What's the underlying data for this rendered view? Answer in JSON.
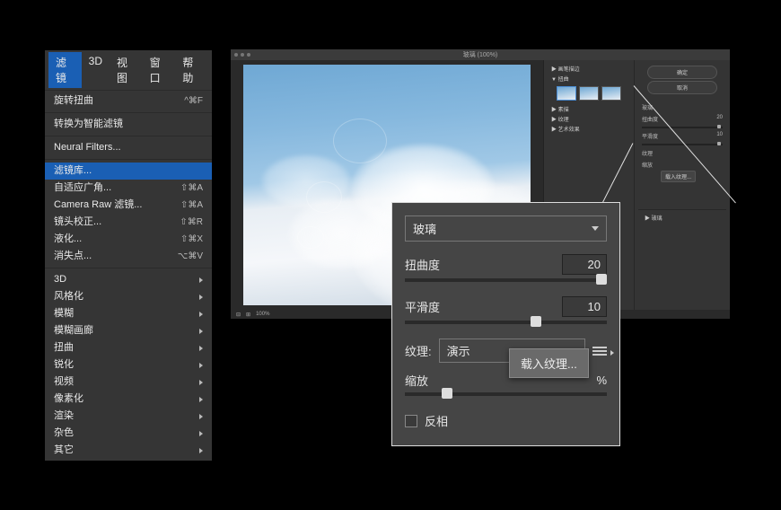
{
  "menubar": {
    "items": [
      "滤镜",
      "3D",
      "视图",
      "窗口",
      "帮助"
    ],
    "active_index": 0
  },
  "menu": {
    "section1": [
      {
        "label": "旋转扭曲",
        "shortcut": "^⌘F"
      }
    ],
    "section2": [
      {
        "label": "转换为智能滤镜"
      }
    ],
    "section3": [
      {
        "label": "Neural Filters..."
      }
    ],
    "section4": [
      {
        "label": "滤镜库...",
        "highlighted": true
      },
      {
        "label": "自适应广角...",
        "shortcut": "⇧⌘A"
      },
      {
        "label": "Camera Raw 滤镜...",
        "shortcut": "⇧⌘A"
      },
      {
        "label": "镜头校正...",
        "shortcut": "⇧⌘R"
      },
      {
        "label": "液化...",
        "shortcut": "⇧⌘X"
      },
      {
        "label": "消失点...",
        "shortcut": "⌥⌘V"
      }
    ],
    "section5": [
      {
        "label": "3D",
        "submenu": true
      },
      {
        "label": "风格化",
        "submenu": true
      },
      {
        "label": "模糊",
        "submenu": true
      },
      {
        "label": "模糊画廊",
        "submenu": true
      },
      {
        "label": "扭曲",
        "submenu": true
      },
      {
        "label": "锐化",
        "submenu": true
      },
      {
        "label": "视频",
        "submenu": true
      },
      {
        "label": "像素化",
        "submenu": true
      },
      {
        "label": "渲染",
        "submenu": true
      },
      {
        "label": "杂色",
        "submenu": true
      },
      {
        "label": "其它",
        "submenu": true
      }
    ]
  },
  "editor": {
    "title": "玻璃 (100%)",
    "zoom": "100%",
    "side": {
      "categories": [
        "▶ 画笔描边",
        "▼ 扭曲",
        "▶ 素描",
        "▶ 纹理",
        "▶ 艺术效果"
      ],
      "ok": "确定",
      "cancel": "取消",
      "mini_effect": "玻璃",
      "params": [
        {
          "label": "扭曲度",
          "value": "20"
        },
        {
          "label": "平滑度",
          "value": "10"
        }
      ],
      "texture_label": "纹理",
      "load_texture": "载入纹理...",
      "scale_label": "缩放",
      "layer_label": "▶ 玻璃"
    }
  },
  "callout": {
    "effect_name": "玻璃",
    "param1_label": "扭曲度",
    "param1_value": "20",
    "param2_label": "平滑度",
    "param2_value": "10",
    "texture_label": "纹理:",
    "texture_value": "演示",
    "load_texture": "载入纹理...",
    "scale_label": "缩放",
    "scale_unit": "%",
    "invert_label": "反相"
  }
}
